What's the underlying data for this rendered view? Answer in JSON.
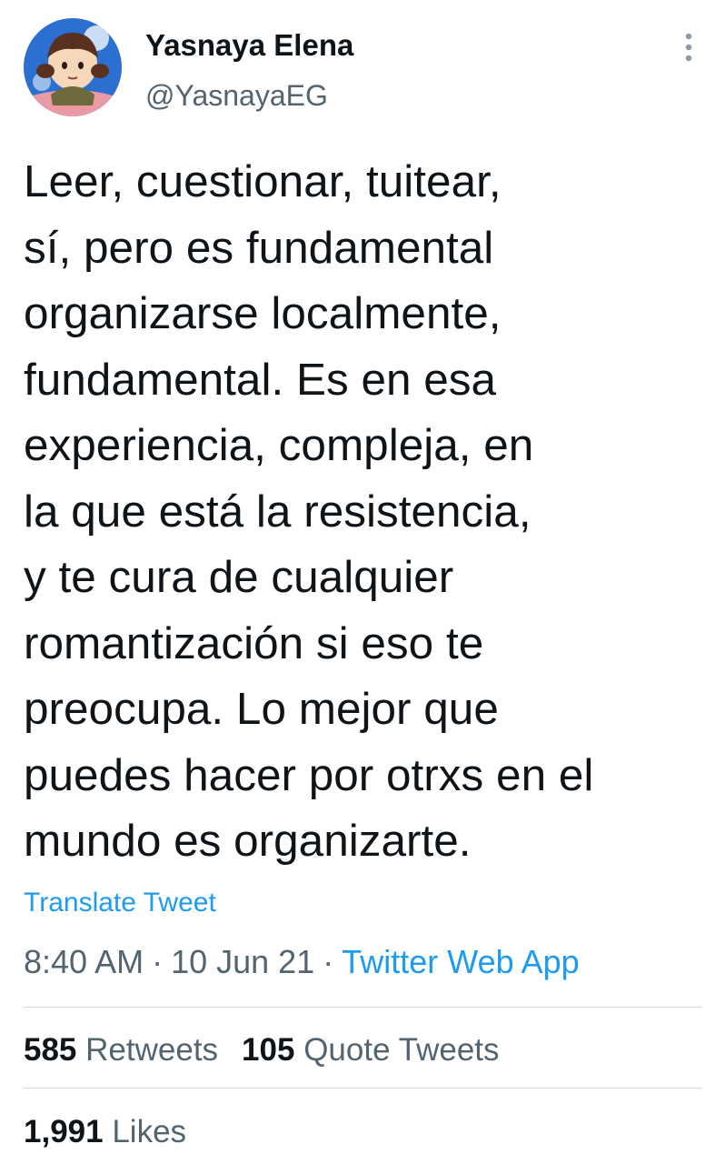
{
  "author": {
    "name": "Yasnaya Elena",
    "handle": "@YasnayaEG",
    "avatar_icon": "avatar-image",
    "more_icon": "more-vertical-icon"
  },
  "tweet": {
    "text_lines": [
      "Leer, cuestionar, tuitear,",
      "sí, pero es fundamental",
      "organizarse localmente,",
      "fundamental. Es en esa",
      "experiencia, compleja, en",
      "la que está la resistencia,",
      "y te cura de cualquier",
      "romantización si eso te",
      "preocupa. Lo mejor que",
      "puedes hacer por otrxs en el",
      "mundo es organizarte."
    ],
    "translate_label": "Translate Tweet",
    "time": "8:40 AM",
    "date": "10 Jun 21",
    "separator": "·",
    "source": "Twitter Web App"
  },
  "stats": {
    "retweets_count": "585",
    "retweets_label": "Retweets",
    "quotes_count": "105",
    "quotes_label": "Quote Tweets",
    "likes_count": "1,991",
    "likes_label": "Likes"
  },
  "colors": {
    "accent": "#1d9bf0",
    "secondary_text": "#536471",
    "primary_text": "#0f1419",
    "divider": "#cfd9de"
  }
}
